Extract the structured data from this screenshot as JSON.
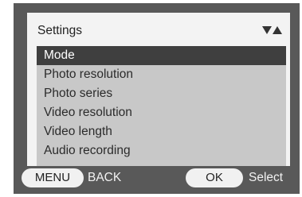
{
  "header": {
    "title": "Settings",
    "scroll_indicator_icon": "scroll-up-down-icon"
  },
  "menu": {
    "selected_index": 0,
    "items": [
      {
        "label": "Mode"
      },
      {
        "label": "Photo resolution"
      },
      {
        "label": "Photo series"
      },
      {
        "label": "Video resolution"
      },
      {
        "label": "Video length"
      },
      {
        "label": "Audio recording"
      }
    ]
  },
  "footer": {
    "menu_key": "MENU",
    "menu_action": "BACK",
    "ok_key": "OK",
    "ok_action": "Select"
  },
  "colors": {
    "frame": "#595959",
    "panel": "#f3f3f3",
    "list_bg": "#c8c8c8",
    "selected_bg": "#3f3f3f"
  }
}
